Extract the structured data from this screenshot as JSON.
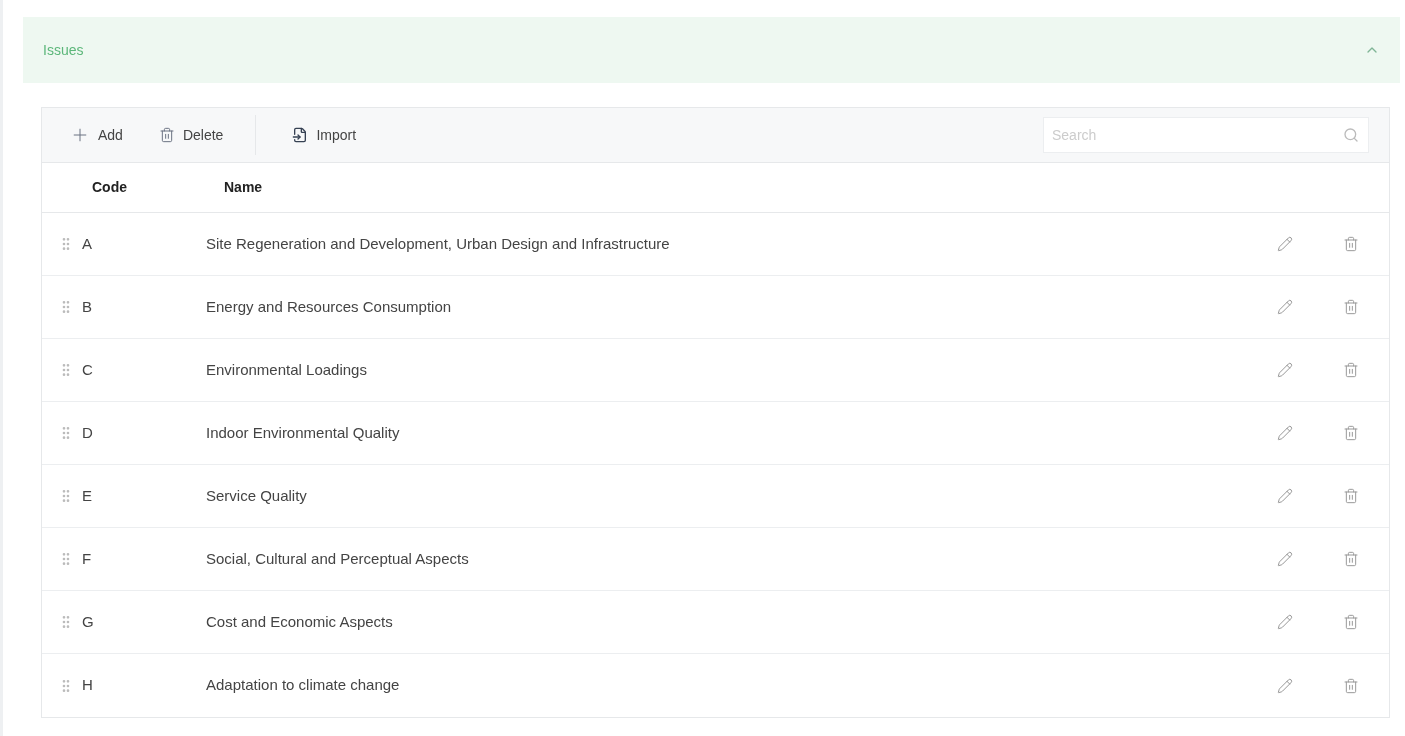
{
  "panel": {
    "title": "Issues",
    "expanded": true
  },
  "toolbar": {
    "buttons": [
      {
        "kind": "add",
        "label": "Add"
      },
      {
        "kind": "delete",
        "label": "Delete"
      },
      {
        "kind": "import",
        "label": "Import"
      }
    ],
    "search": {
      "placeholder": "Search"
    }
  },
  "table": {
    "columns": [
      "Code",
      "Name"
    ],
    "rows": [
      {
        "code": "A",
        "name": "Site Regeneration and Development, Urban Design and Infrastructure"
      },
      {
        "code": "B",
        "name": "Energy and Resources Consumption"
      },
      {
        "code": "C",
        "name": "Environmental Loadings"
      },
      {
        "code": "D",
        "name": "Indoor Environmental Quality"
      },
      {
        "code": "E",
        "name": "Service Quality"
      },
      {
        "code": "F",
        "name": "Social, Cultural and Perceptual Aspects"
      },
      {
        "code": "G",
        "name": "Cost and Economic Aspects"
      },
      {
        "code": "H",
        "name": "Adaptation to climate change"
      }
    ]
  }
}
